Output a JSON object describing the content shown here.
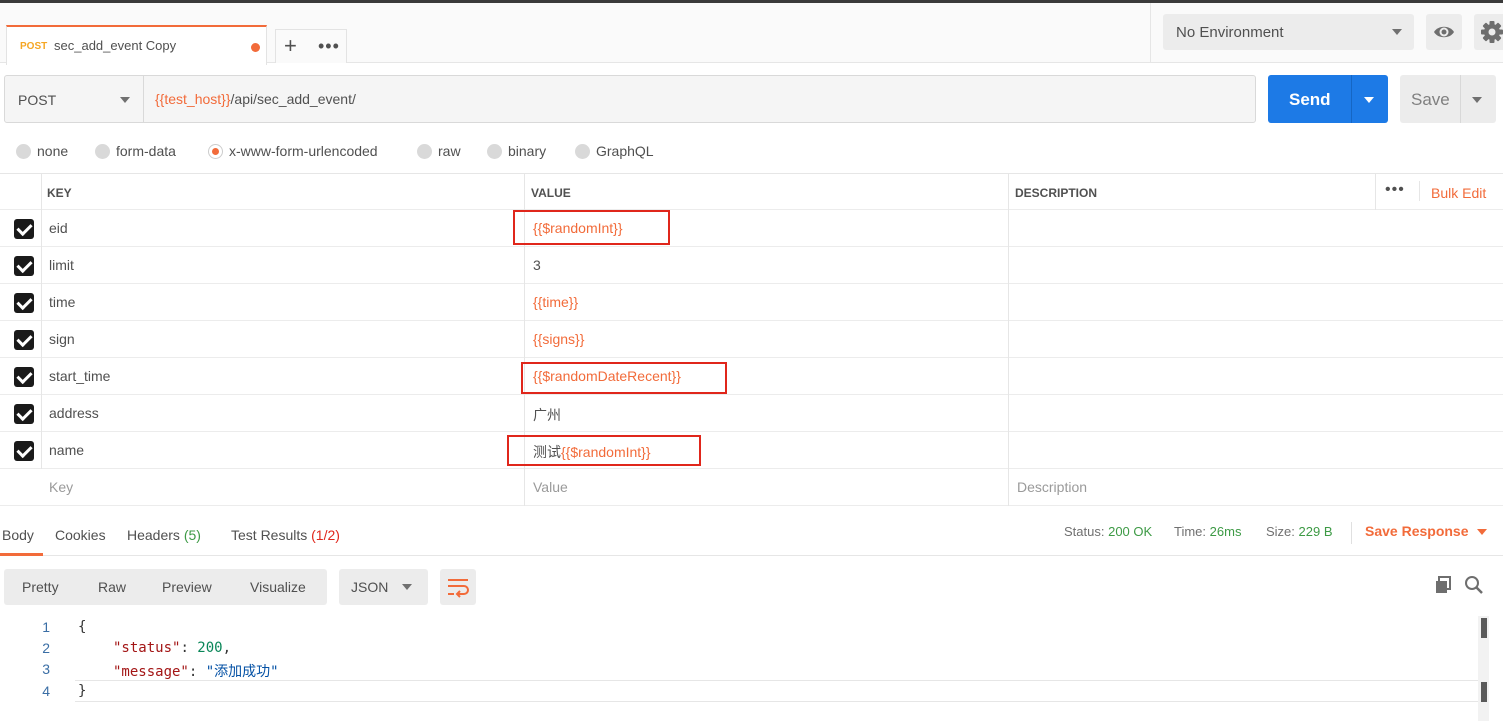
{
  "tab": {
    "method": "POST",
    "title": "sec_add_event Copy"
  },
  "environment": {
    "selected": "No Environment"
  },
  "request": {
    "method": "POST",
    "url_var": "{{test_host}}",
    "url_path": "/api/sec_add_event/",
    "send_label": "Send",
    "save_label": "Save"
  },
  "body_types": [
    "none",
    "form-data",
    "x-www-form-urlencoded",
    "raw",
    "binary",
    "GraphQL"
  ],
  "table": {
    "headers": {
      "key": "KEY",
      "value": "VALUE",
      "description": "DESCRIPTION"
    },
    "bulk_edit": "Bulk Edit",
    "rows": [
      {
        "key": "eid",
        "value_prefix": "",
        "value_var": "{{$randomInt}}"
      },
      {
        "key": "limit",
        "value_prefix": "3",
        "value_var": ""
      },
      {
        "key": "time",
        "value_prefix": "",
        "value_var": "{{time}}"
      },
      {
        "key": "sign",
        "value_prefix": "",
        "value_var": "{{signs}}"
      },
      {
        "key": "start_time",
        "value_prefix": "",
        "value_var": "{{$randomDateRecent}}"
      },
      {
        "key": "address",
        "value_prefix": "广州",
        "value_var": ""
      },
      {
        "key": "name",
        "value_prefix": "测试",
        "value_var": "{{$randomInt}}"
      }
    ],
    "placeholders": {
      "key": "Key",
      "value": "Value",
      "description": "Description"
    }
  },
  "response": {
    "tabs": {
      "body": "Body",
      "cookies": "Cookies",
      "headers": "Headers",
      "headers_count": "(5)",
      "tests": "Test Results",
      "tests_count": "(1/2)"
    },
    "status_label": "Status:",
    "status_value": "200 OK",
    "time_label": "Time:",
    "time_value": "26ms",
    "size_label": "Size:",
    "size_value": "229 B",
    "save_response": "Save Response",
    "views": [
      "Pretty",
      "Raw",
      "Preview",
      "Visualize"
    ],
    "format": "JSON",
    "code": {
      "line_numbers": [
        "1",
        "2",
        "3",
        "4"
      ],
      "open_brace": "{",
      "status_key": "\"status\"",
      "status_val": "200",
      "message_key": "\"message\"",
      "message_val": "\"添加成功\"",
      "close_brace": "}"
    }
  },
  "colors": {
    "accent": "#f26b3a",
    "send": "#1d7ae6",
    "success": "#3d9a45",
    "highlight_box": "#e0261b"
  }
}
